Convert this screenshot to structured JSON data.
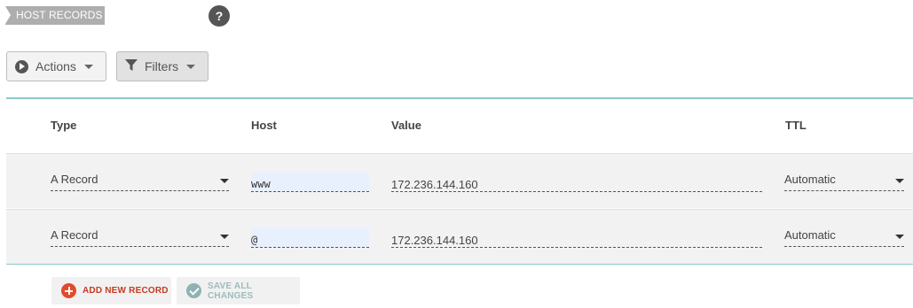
{
  "section": {
    "title": "HOST RECORDS",
    "help_icon": "?"
  },
  "toolbar": {
    "actions_label": "Actions",
    "filters_label": "Filters"
  },
  "table": {
    "headers": {
      "type": "Type",
      "host": "Host",
      "value": "Value",
      "ttl": "TTL"
    },
    "rows": [
      {
        "type": "A Record",
        "host": "www",
        "value": "172.236.144.160",
        "ttl": "Automatic"
      },
      {
        "type": "A Record",
        "host": "@",
        "value": "172.236.144.160",
        "ttl": "Automatic"
      }
    ]
  },
  "footer": {
    "add_label": "ADD NEW RECORD",
    "save_label": "SAVE ALL CHANGES"
  },
  "colors": {
    "accent_border": "#8cc9c9",
    "add_red": "#e24a2b",
    "save_teal": "#8fb3b3"
  },
  "icons": [
    "play-circle-icon",
    "filter-icon",
    "chevron-down-icon",
    "help-icon",
    "plus-circle-icon",
    "check-circle-icon"
  ]
}
